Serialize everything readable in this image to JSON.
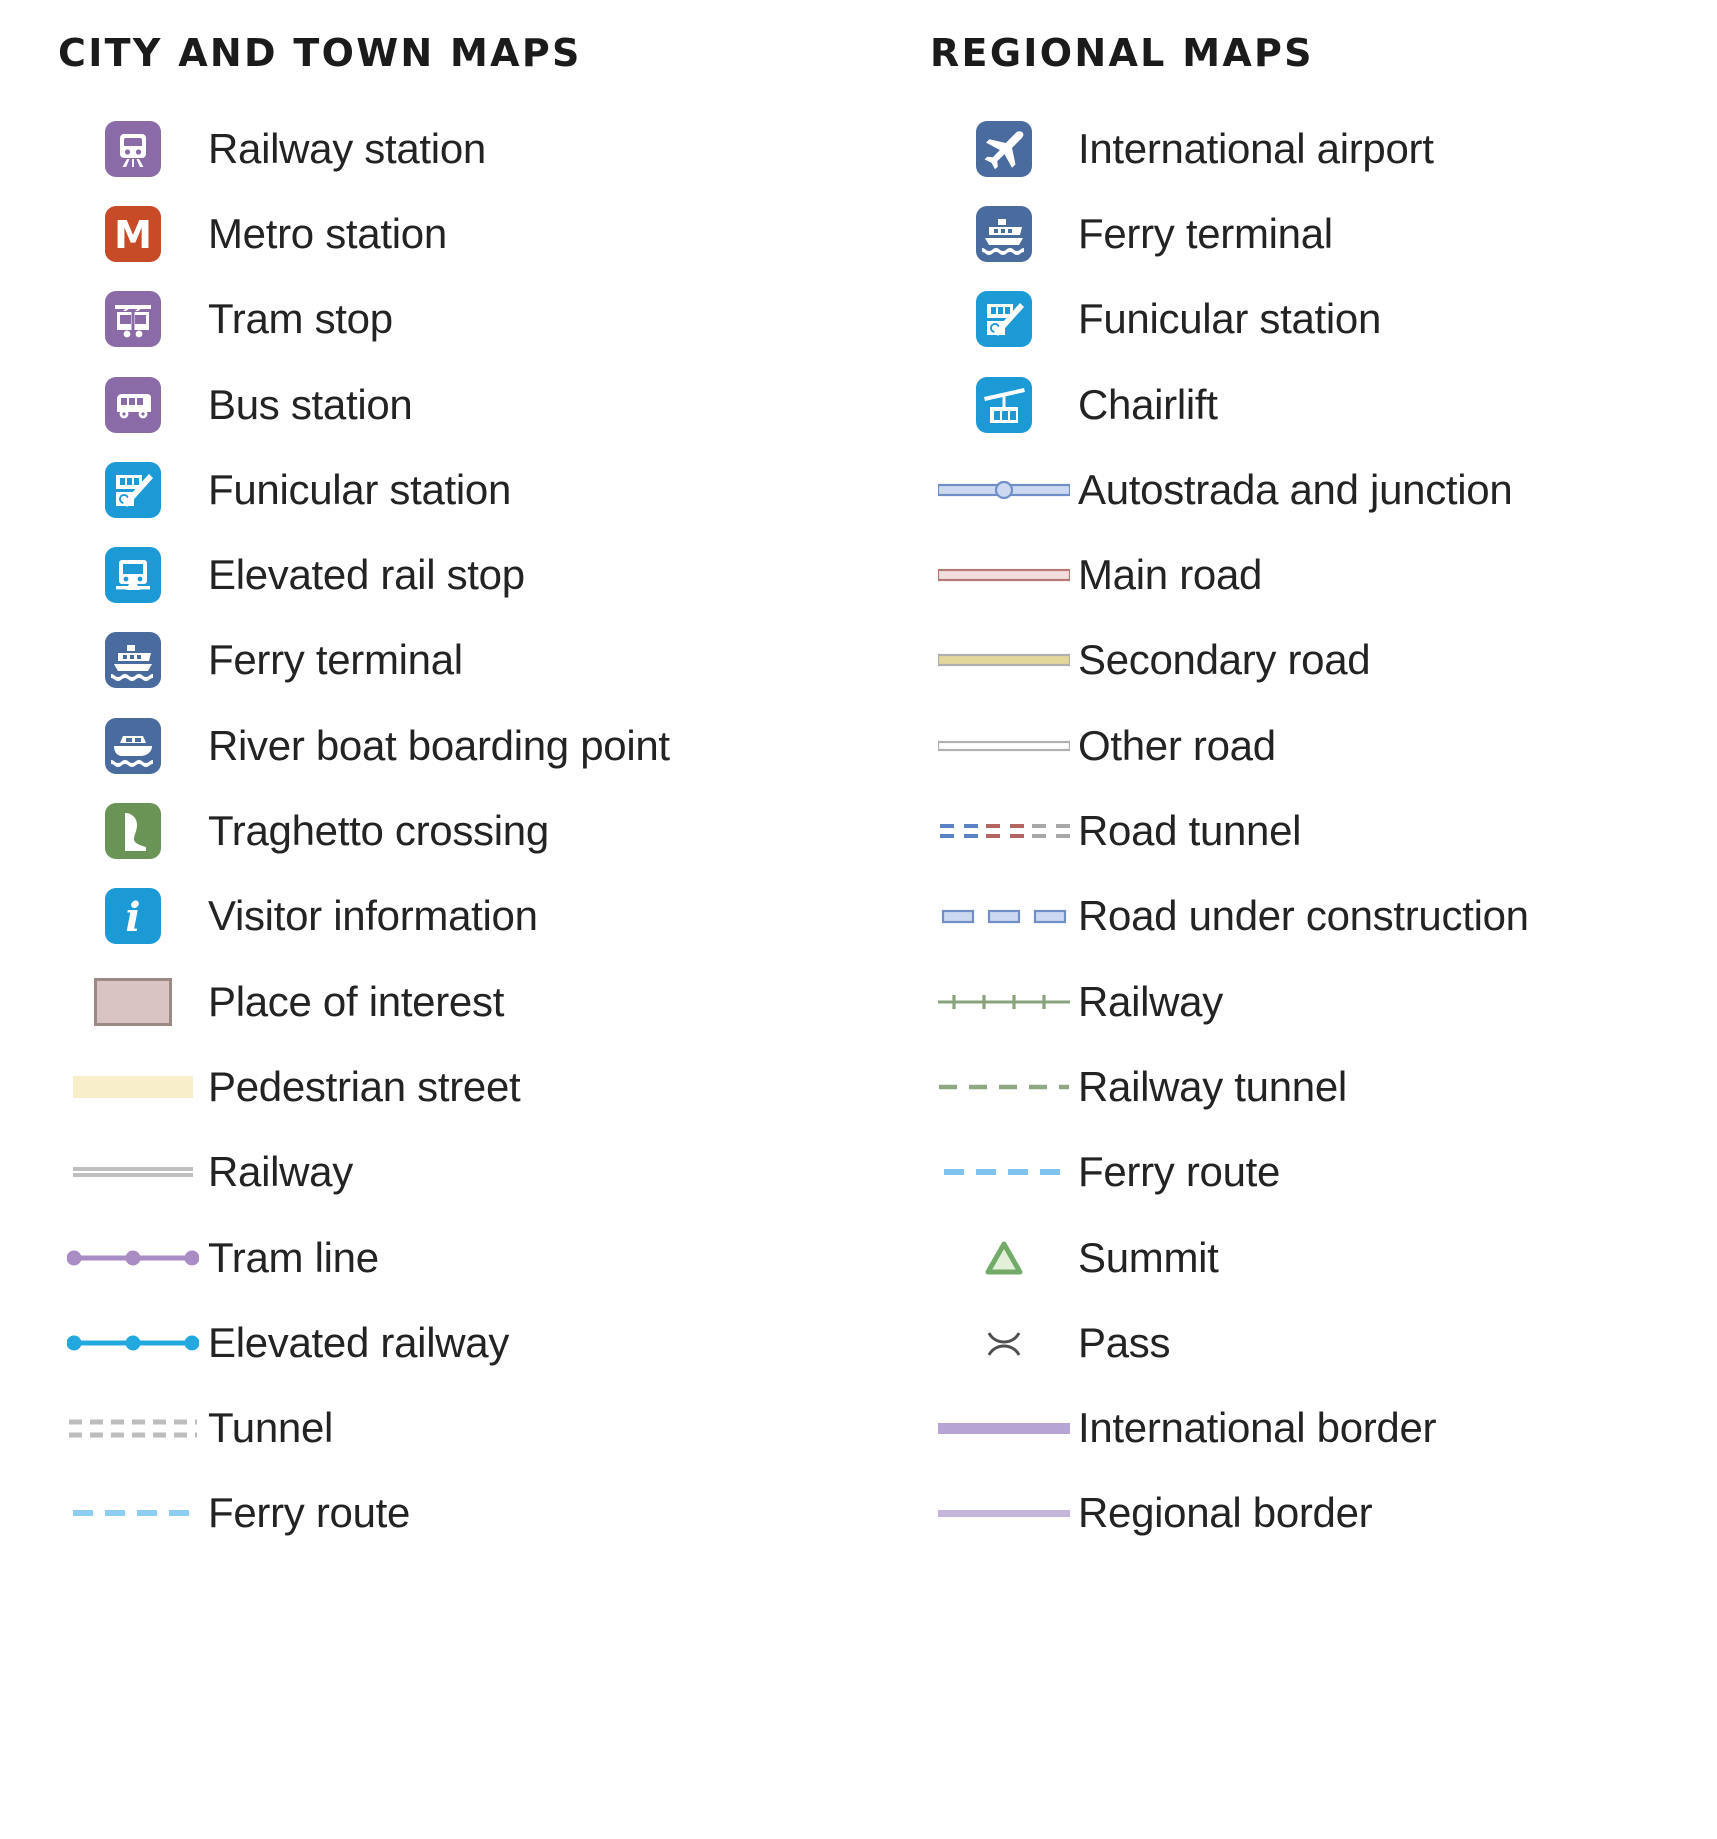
{
  "columns": [
    {
      "title": "CITY AND TOWN MAPS",
      "items": [
        {
          "label": "Railway station",
          "symbol": "tile-railway-station",
          "color": "#8a6ba8"
        },
        {
          "label": "Metro station",
          "symbol": "tile-metro-station",
          "color": "#c84b28"
        },
        {
          "label": "Tram stop",
          "symbol": "tile-tram-stop",
          "color": "#8a6ba8"
        },
        {
          "label": "Bus station",
          "symbol": "tile-bus-station",
          "color": "#8a6ba8"
        },
        {
          "label": "Funicular station",
          "symbol": "tile-funicular",
          "color": "#1b9ad6"
        },
        {
          "label": "Elevated rail stop",
          "symbol": "tile-elevated-rail",
          "color": "#1b9ad6"
        },
        {
          "label": "Ferry terminal",
          "symbol": "tile-ferry",
          "color": "#4a6b9e"
        },
        {
          "label": "River boat boarding point",
          "symbol": "tile-river-boat",
          "color": "#4a6b9e"
        },
        {
          "label": "Traghetto crossing",
          "symbol": "tile-traghetto",
          "color": "#6a9455"
        },
        {
          "label": "Visitor information",
          "symbol": "tile-information",
          "color": "#1b9ad6"
        },
        {
          "label": "Place of interest",
          "symbol": "swatch-poi",
          "color": "#d9c3c3"
        },
        {
          "label": "Pedestrian street",
          "symbol": "swatch-pedestrian",
          "color": "#f8eec9"
        },
        {
          "label": "Railway",
          "symbol": "line-railway-city",
          "color": "#bfbfbf"
        },
        {
          "label": "Tram line",
          "symbol": "line-tram",
          "color": "#a98cc4"
        },
        {
          "label": "Elevated railway",
          "symbol": "line-elevated-railway",
          "color": "#23a8e0"
        },
        {
          "label": "Tunnel",
          "symbol": "line-tunnel",
          "color": "#bdbdbd"
        },
        {
          "label": "Ferry route",
          "symbol": "line-ferry-route",
          "color": "#8ecdf2"
        }
      ]
    },
    {
      "title": "REGIONAL MAPS",
      "items": [
        {
          "label": "International airport",
          "symbol": "tile-airport",
          "color": "#4a6b9e"
        },
        {
          "label": "Ferry terminal",
          "symbol": "tile-ferry",
          "color": "#4a6b9e"
        },
        {
          "label": "Funicular station",
          "symbol": "tile-funicular",
          "color": "#1b9ad6"
        },
        {
          "label": "Chairlift",
          "symbol": "tile-chairlift",
          "color": "#1b9ad6"
        },
        {
          "label": "Autostrada and junction",
          "symbol": "line-autostrada",
          "color": "#c6d4ef"
        },
        {
          "label": "Main road",
          "symbol": "line-main-road",
          "color": "#f0d7d7"
        },
        {
          "label": "Secondary road",
          "symbol": "line-secondary-road",
          "color": "#e4d79a"
        },
        {
          "label": "Other road",
          "symbol": "line-other-road",
          "color": "#ffffff"
        },
        {
          "label": "Road tunnel",
          "symbol": "line-road-tunnel",
          "color": "#6f8fc6"
        },
        {
          "label": "Road under construction",
          "symbol": "line-road-construction",
          "color": "#c6d4ef"
        },
        {
          "label": "Railway",
          "symbol": "line-railway-regional",
          "color": "#88a37c"
        },
        {
          "label": "Railway tunnel",
          "symbol": "line-railway-tunnel",
          "color": "#8ea884"
        },
        {
          "label": "Ferry route",
          "symbol": "line-ferry-route",
          "color": "#7fc4ef"
        },
        {
          "label": "Summit",
          "symbol": "marker-summit",
          "color": "#72ab68"
        },
        {
          "label": "Pass",
          "symbol": "marker-pass",
          "color": "#5a5a5a"
        },
        {
          "label": "International border",
          "symbol": "line-intl-border",
          "color": "#b6a4d4"
        },
        {
          "label": "Regional border",
          "symbol": "line-regional-border",
          "color": "#c4b5dd"
        }
      ]
    }
  ]
}
